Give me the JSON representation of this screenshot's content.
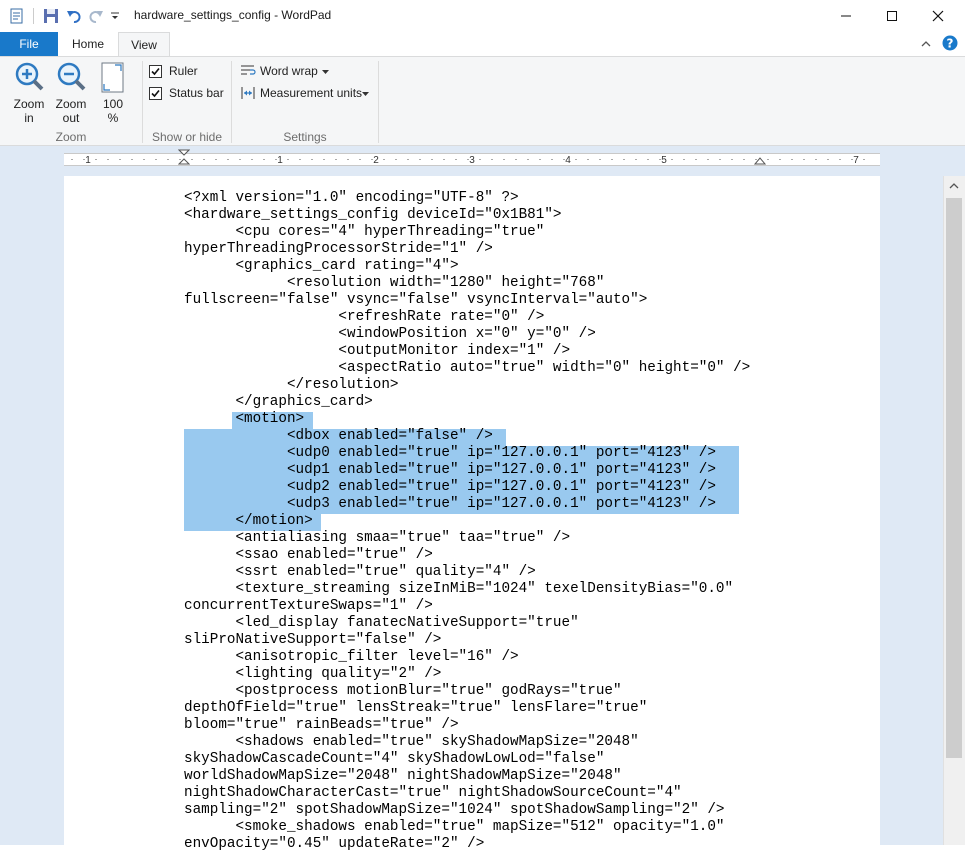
{
  "window": {
    "title": "hardware_settings_config - WordPad",
    "minimize": "—",
    "maximize": "☐",
    "close": "✕"
  },
  "tabs": [
    "File",
    "Home",
    "View"
  ],
  "ribbon": {
    "zoom_in": [
      "Zoom",
      "in"
    ],
    "zoom_out": [
      "Zoom",
      "out"
    ],
    "zoom_100": [
      "100",
      "%"
    ],
    "zoom_group": "Zoom",
    "ruler": {
      "label": "Ruler",
      "checked": true
    },
    "status_bar": {
      "label": "Status bar",
      "checked": true
    },
    "show_hide_group": "Show or hide",
    "word_wrap": "Word wrap",
    "measurement_units": "Measurement units",
    "settings_group": "Settings"
  },
  "ruler_numbers": [
    "1",
    "1",
    "2",
    "3",
    "4",
    "5",
    "7"
  ],
  "document_lines": [
    "<?xml version=\"1.0\" encoding=\"UTF-8\" ?>",
    "<hardware_settings_config deviceId=\"0x1B81\">",
    "      <cpu cores=\"4\" hyperThreading=\"true\"",
    "hyperThreadingProcessorStride=\"1\" />",
    "      <graphics_card rating=\"4\">",
    "            <resolution width=\"1280\" height=\"768\"",
    "fullscreen=\"false\" vsync=\"false\" vsyncInterval=\"auto\">",
    "                  <refreshRate rate=\"0\" />",
    "                  <windowPosition x=\"0\" y=\"0\" />",
    "                  <outputMonitor index=\"1\" />",
    "                  <aspectRatio auto=\"true\" width=\"0\" height=\"0\" />",
    "            </resolution>",
    "      </graphics_card>",
    "      <motion>",
    "            <dbox enabled=\"false\" />",
    "            <udp0 enabled=\"true\" ip=\"127.0.0.1\" port=\"4123\" />",
    "            <udp1 enabled=\"true\" ip=\"127.0.0.1\" port=\"4123\" />",
    "            <udp2 enabled=\"true\" ip=\"127.0.0.1\" port=\"4123\" />",
    "            <udp3 enabled=\"true\" ip=\"127.0.0.1\" port=\"4123\" />",
    "      </motion>",
    "      <antialiasing smaa=\"true\" taa=\"true\" />",
    "      <ssao enabled=\"true\" />",
    "      <ssrt enabled=\"true\" quality=\"4\" />",
    "      <texture_streaming sizeInMiB=\"1024\" texelDensityBias=\"0.0\"",
    "concurrentTextureSwaps=\"1\" />",
    "      <led_display fanatecNativeSupport=\"true\"",
    "sliProNativeSupport=\"false\" />",
    "      <anisotropic_filter level=\"16\" />",
    "      <lighting quality=\"2\" />",
    "      <postprocess motionBlur=\"true\" godRays=\"true\"",
    "depthOfField=\"true\" lensStreak=\"true\" lensFlare=\"true\"",
    "bloom=\"true\" rainBeads=\"true\" />",
    "      <shadows enabled=\"true\" skyShadowMapSize=\"2048\"",
    "skyShadowCascadeCount=\"4\" skyShadowLowLod=\"false\"",
    "worldShadowMapSize=\"2048\" nightShadowMapSize=\"2048\"",
    "nightShadowCharacterCast=\"true\" nightShadowSourceCount=\"4\"",
    "sampling=\"2\" spotShadowMapSize=\"1024\" spotShadowSampling=\"2\" />",
    "      <smoke_shadows enabled=\"true\" mapSize=\"512\" opacity=\"1.0\"",
    "envOpacity=\"0.45\" updateRate=\"2\" />"
  ]
}
